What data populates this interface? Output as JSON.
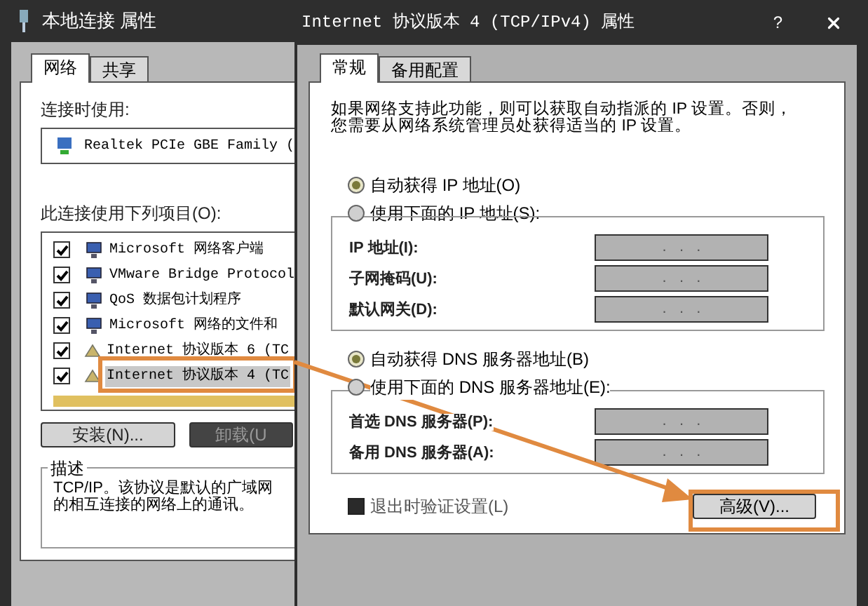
{
  "left_window": {
    "title": "本地连接 属性",
    "tabs": [
      {
        "label": "网络",
        "selected": true
      },
      {
        "label": "共享",
        "selected": false
      }
    ],
    "connect_using_label": "连接时使用:",
    "adapter": "Realtek PCIe GBE Family (",
    "items_label": "此连接使用下列项目(O):",
    "items": [
      {
        "label": "Microsoft 网络客户端",
        "checked": true,
        "selected": false,
        "kind": "network"
      },
      {
        "label": "VMware Bridge Protocol",
        "checked": true,
        "selected": false,
        "kind": "network"
      },
      {
        "label": "QoS 数据包计划程序",
        "checked": true,
        "selected": false,
        "kind": "network"
      },
      {
        "label": "Microsoft 网络的文件和",
        "checked": true,
        "selected": false,
        "kind": "network"
      },
      {
        "label": "Internet 协议版本 6 (TC",
        "checked": true,
        "selected": false,
        "kind": "protocol"
      },
      {
        "label": "Internet 协议版本 4 (TC",
        "checked": true,
        "selected": true,
        "kind": "protocol"
      }
    ],
    "buttons": [
      {
        "label": "安装(N)...",
        "disabled": false
      },
      {
        "label": "卸载(U",
        "disabled": true
      }
    ],
    "description_title": "描述",
    "description_lines": [
      "TCP/IP。该协议是默认的广域网",
      "的相互连接的网络上的通讯。"
    ]
  },
  "right_window": {
    "title": "Internet 协议版本 4 (TCP/IPv4) 属性",
    "help_label": "?",
    "tabs": [
      {
        "label": "常规",
        "selected": true
      },
      {
        "label": "备用配置",
        "selected": false
      }
    ],
    "intro_lines": [
      "如果网络支持此功能，则可以获取自动指派的 IP 设置。否则，",
      "您需要从网络系统管理员处获得适当的 IP 设置。"
    ],
    "ip_options": [
      {
        "label": "自动获得 IP 地址(O)",
        "selected": true
      },
      {
        "label": "使用下面的 IP 地址(S):",
        "selected": false
      }
    ],
    "ip_fields": [
      {
        "label": "IP 地址(I):",
        "value": ".   .   .",
        "disabled": true
      },
      {
        "label": "子网掩码(U):",
        "value": ".   .   .",
        "disabled": true
      },
      {
        "label": "默认网关(D):",
        "value": ".   .   .",
        "disabled": true
      }
    ],
    "dns_options": [
      {
        "label": "自动获得 DNS 服务器地址(B)",
        "selected": true
      },
      {
        "label": "使用下面的 DNS 服务器地址(E):",
        "selected": false
      }
    ],
    "dns_fields": [
      {
        "label": "首选 DNS 服务器(P):",
        "value": ".   .   .",
        "disabled": true
      },
      {
        "label": "备用 DNS 服务器(A):",
        "value": ".   .   .",
        "disabled": true
      }
    ],
    "validate_checkbox": {
      "label": "退出时验证设置(L)",
      "checked": false
    },
    "advanced_button": "高级(V)..."
  }
}
